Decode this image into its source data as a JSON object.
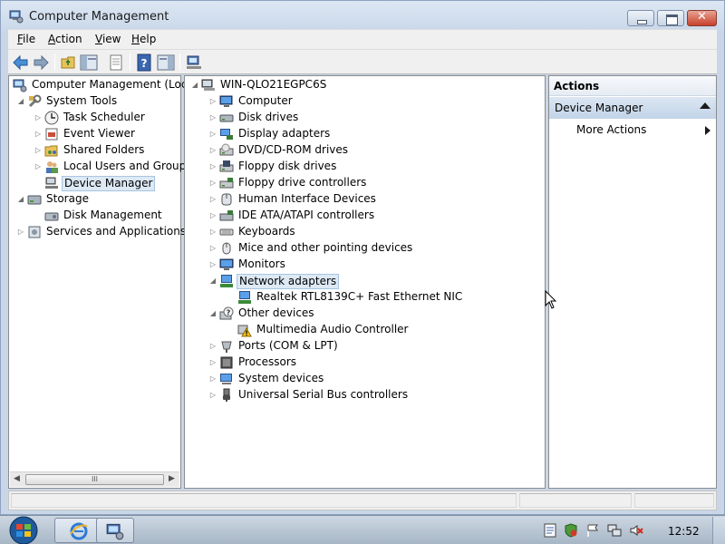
{
  "window": {
    "title": "Computer Management"
  },
  "menu": [
    {
      "label": "File",
      "key": "F",
      "rest": "ile"
    },
    {
      "label": "Action",
      "key": "A",
      "rest": "ction"
    },
    {
      "label": "View",
      "key": "V",
      "rest": "iew"
    },
    {
      "label": "Help",
      "key": "H",
      "rest": "elp"
    }
  ],
  "toolbar": [
    "back-arrow-icon",
    "forward-arrow-icon",
    "up-folder-icon",
    "show-hide-console-tree-icon",
    "properties-icon",
    "help-icon",
    "show-hide-action-pane-icon",
    "scan-hardware-icon"
  ],
  "left_tree": {
    "root": "Computer Management (Local",
    "system_tools": "System Tools",
    "task_scheduler": "Task Scheduler",
    "event_viewer": "Event Viewer",
    "shared_folders": "Shared Folders",
    "local_users": "Local Users and Groups",
    "device_manager": "Device Manager",
    "storage": "Storage",
    "disk_management": "Disk Management",
    "services": "Services and Applications",
    "scroll_thumb": "III"
  },
  "device_tree": {
    "host": "WIN-QLO21EGPC6S",
    "categories": {
      "computer": "Computer",
      "disk_drives": "Disk drives",
      "display_adapters": "Display adapters",
      "dvd": "DVD/CD-ROM drives",
      "floppy_drives": "Floppy disk drives",
      "floppy_controllers": "Floppy drive controllers",
      "hid": "Human Interface Devices",
      "ide": "IDE ATA/ATAPI controllers",
      "keyboards": "Keyboards",
      "mice": "Mice and other pointing devices",
      "monitors": "Monitors",
      "network": "Network adapters",
      "network_child": "Realtek RTL8139C+ Fast Ethernet NIC",
      "other": "Other devices",
      "other_child": "Multimedia Audio Controller",
      "ports": "Ports (COM & LPT)",
      "processors": "Processors",
      "system": "System devices",
      "usb": "Universal Serial Bus controllers"
    }
  },
  "actions": {
    "header": "Actions",
    "section": "Device Manager",
    "more": "More Actions"
  },
  "taskbar": {
    "clock": "12:52"
  },
  "colors": {
    "selection": "#dde9f5",
    "actions_section": "#c3d4e8",
    "close_button": "#c7412b"
  }
}
